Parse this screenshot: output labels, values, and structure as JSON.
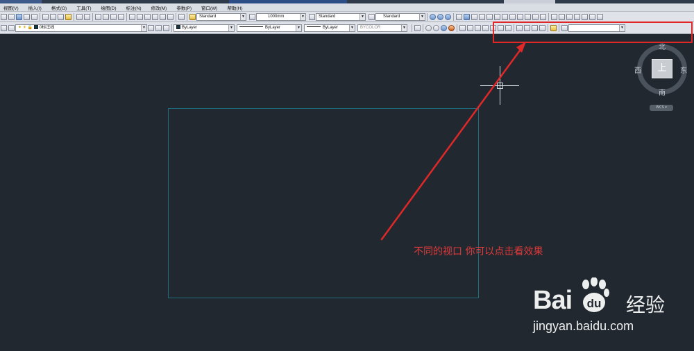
{
  "menu": [
    "视图(V)",
    "插入(I)",
    "格式(O)",
    "工具(T)",
    "绘图(D)",
    "标注(N)",
    "修改(M)",
    "参数(P)",
    "窗口(W)",
    "帮助(H)"
  ],
  "styles": {
    "text_style": "Standard",
    "dim_scale": "1000mm",
    "table_style": "Standard",
    "multileader_style": "Standard"
  },
  "properties": {
    "layer": "0标注线",
    "color": "ByLayer",
    "linetype": "ByLayer",
    "lineweight": "ByLayer",
    "plot_style": "BYCOLOR"
  },
  "view_combo": "",
  "viewcube": {
    "north": "北",
    "south": "南",
    "east": "东",
    "west": "西",
    "face": "上",
    "wcs": "WCS ▾"
  },
  "annotation": "不同的视口 你可以点击看效果",
  "watermark": {
    "brand_left": "Bai",
    "brand_right": "经验",
    "url": "jingyan.baidu.com"
  },
  "colors": {
    "canvas": "#212830",
    "annotation_red": "#e02828",
    "rectangle": "#1e6e80"
  }
}
